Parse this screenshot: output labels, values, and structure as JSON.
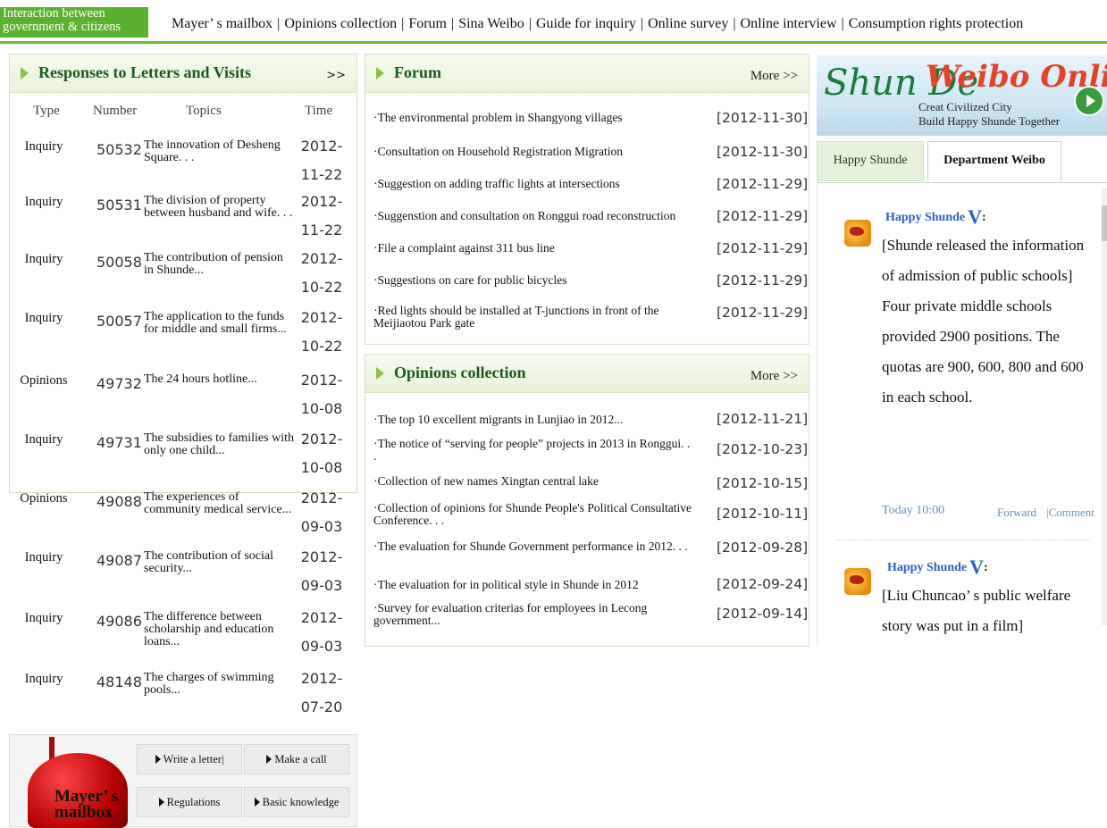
{
  "header": {
    "logo_line1": "Interaction between",
    "logo_line2": "government & citizens",
    "nav": [
      "Mayer’ s mailbox",
      "Opinions collection",
      "Forum",
      "Sina Weibo",
      "Guide for inquiry",
      "Online survey",
      "Online interview",
      "Consumption rights protection"
    ]
  },
  "letters": {
    "title": "Responses to Letters and Visits",
    "more": ">>",
    "columns": [
      "Type",
      "Number",
      "Topics",
      "Time"
    ],
    "rows": [
      {
        "type": "Inquiry",
        "number": "50532",
        "topic": "The innovation of Desheng Square. . .",
        "time": "2012-11-22"
      },
      {
        "type": "Inquiry",
        "number": "50531",
        "topic": "The division of property between husband and wife. . .",
        "time": "2012-11-22"
      },
      {
        "type": "Inquiry",
        "number": "50058",
        "topic": "The contribution of pension in Shunde...",
        "time": "2012-10-22"
      },
      {
        "type": "Inquiry",
        "number": "50057",
        "topic": "The application to the funds for middle and small firms...",
        "time": "2012-10-22"
      },
      {
        "type": "Opinions",
        "number": "49732",
        "topic": "The 24 hours hotline...",
        "time": "2012-10-08"
      },
      {
        "type": "Inquiry",
        "number": "49731",
        "topic": "The subsidies to families with only one child...",
        "time": "2012-10-08"
      },
      {
        "type": "Opinions",
        "number": "49088",
        "topic": "The experiences of community medical service...",
        "time": "2012-09-03"
      },
      {
        "type": "Inquiry",
        "number": "49087",
        "topic": "The contribution of social security...",
        "time": "2012-09-03"
      },
      {
        "type": "Inquiry",
        "number": "49086",
        "topic": "The difference between scholarship and education loans...",
        "time": "2012-09-03"
      },
      {
        "type": "Inquiry",
        "number": "48148",
        "topic": "The charges of swimming pools...",
        "time": "2012-07-20"
      }
    ]
  },
  "mailbox": {
    "label1": "Mayer’ s",
    "label2": "mailbox",
    "buttons": [
      "Write a letter|",
      "Make a call",
      "Regulations",
      "Basic knowledge"
    ]
  },
  "forum": {
    "title": "Forum",
    "more": "More >>",
    "items": [
      {
        "text": "·The environmental problem in Shangyong villages",
        "date": "[2012-11-30]"
      },
      {
        "text": "·Consultation on Household Registration Migration",
        "date": "[2012-11-30]"
      },
      {
        "text": "·Suggestion on adding traffic lights at intersections",
        "date": "[2012-11-29]"
      },
      {
        "text": "·Suggenstion and consultation on Ronggui road reconstruction",
        "date": "[2012-11-29]"
      },
      {
        "text": "·File a complaint against 311 bus line",
        "date": "[2012-11-29]"
      },
      {
        "text": "·Suggestions on care for public bicycles",
        "date": "[2012-11-29]"
      },
      {
        "text": "·Red lights should be installed at T-junctions in front of  the Meijiaotou Park gate",
        "date": "[2012-11-29]"
      }
    ]
  },
  "opinions": {
    "title": "Opinions collection",
    "more": "More >>",
    "items": [
      {
        "text": "·The top 10 excellent migrants in Lunjiao in 2012...",
        "date": "[2012-11-21]"
      },
      {
        "text": "·The notice of “serving for people” projects in 2013 in Ronggui. . .",
        "date": "[2012-10-23]"
      },
      {
        "text": "·Collection of new names Xingtan central lake",
        "date": "[2012-10-15]"
      },
      {
        "text": "·Collection of opinions for Shunde People's Political Consultative Conference. . .",
        "date": "[2012-10-11]"
      },
      {
        "text": "·The evaluation for Shunde Government performance in 2012. . .",
        "date": "[2012-09-28]"
      },
      {
        "text": "·The evaluation for in political style in Shunde in 2012",
        "date": "[2012-09-24]"
      },
      {
        "text": "·Survey for evaluation criterias for employees in Lecong government...",
        "date": "[2012-09-14]"
      }
    ]
  },
  "weibo": {
    "banner_left": "Shun De",
    "banner_right": "Weibo Online",
    "banner_line1": "Creat Civilized City",
    "banner_line2": "Build Happy Shunde Together",
    "tabs": [
      "Happy Shunde",
      "Department Weibo"
    ],
    "posts": [
      {
        "author": "Happy Shunde",
        "badge": "V",
        "colon": ":",
        "text": "[Shunde released the information of admission of public schools] Four private middle schools provided 2900 positions. The quotas are 900, 600, 800 and 600 in each school.",
        "time": "Today 10:00",
        "forward": "Forward",
        "comment": "|Comment"
      },
      {
        "author": "Happy Shunde",
        "badge": "V",
        "colon": ":",
        "text": "[Liu Chuncao’ s public welfare story was put in a film]"
      }
    ]
  }
}
